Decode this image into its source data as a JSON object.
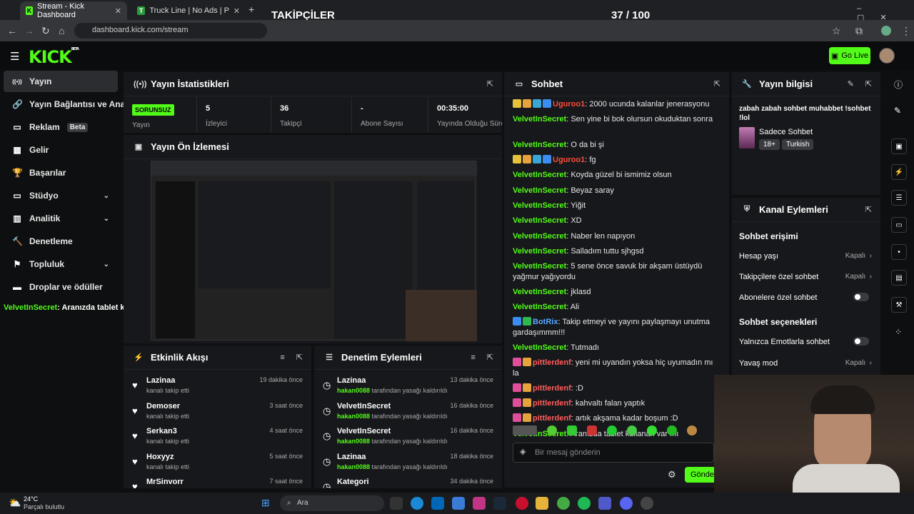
{
  "browser": {
    "tabs": [
      {
        "title": "Stream - Kick Dashboard",
        "active": true
      },
      {
        "title": "Truck Line | No Ads | Play At Fri",
        "active": false
      }
    ],
    "url": "dashboard.kick.com/stream"
  },
  "overlay": {
    "title": "TAKİPÇİLER",
    "count": "37 / 100",
    "progress": 0.37
  },
  "topbar": {
    "logo": "KICK",
    "logo_sup": "BETA",
    "go_live": "Go Live"
  },
  "sidebar": {
    "items": [
      {
        "label": "Yayın",
        "icon": "broadcast-icon",
        "active": true
      },
      {
        "label": "Yayın Bağlantısı ve Anahtarı",
        "icon": "link-icon"
      },
      {
        "label": "Reklam",
        "icon": "ad-icon",
        "badge": "Beta"
      },
      {
        "label": "Gelir",
        "icon": "revenue-icon"
      },
      {
        "label": "Başarılar",
        "icon": "trophy-icon"
      },
      {
        "label": "Stüdyo",
        "icon": "studio-icon",
        "expandable": true
      },
      {
        "label": "Analitik",
        "icon": "analytics-icon",
        "expandable": true
      },
      {
        "label": "Denetleme",
        "icon": "moderation-icon"
      },
      {
        "label": "Topluluk",
        "icon": "community-icon",
        "expandable": true
      },
      {
        "label": "Droplar ve ödüller",
        "icon": "drops-icon"
      }
    ],
    "overlay_chat_user": "VelvetInSecret",
    "overlay_chat_text": ": Aranızda tablet kullanan var mı"
  },
  "stats": {
    "title": "Yayın İstatistikleri",
    "status_badge": "SORUNSUZ",
    "status_label": "Yayın",
    "cells": [
      {
        "value": "5",
        "label": "İzleyici"
      },
      {
        "value": "36",
        "label": "Takipçi"
      },
      {
        "value": "-",
        "label": "Abone Sayısı"
      },
      {
        "value": "00:35:00",
        "label": "Yayında Olduğu Süre"
      }
    ]
  },
  "preview": {
    "title": "Yayın Ön İzlemesi"
  },
  "activity": {
    "title": "Etkinlik Akışı",
    "items": [
      {
        "name": "Lazinaa",
        "sub": "kanalı takip etti",
        "time": "19 dakika önce"
      },
      {
        "name": "Demoser",
        "sub": "kanalı takip etti",
        "time": "3 saat önce"
      },
      {
        "name": "Serkan3",
        "sub": "kanalı takip etti",
        "time": "4 saat önce"
      },
      {
        "name": "Hoxyyz",
        "sub": "kanalı takip etti",
        "time": "5 saat önce"
      },
      {
        "name": "MrSinvorr",
        "sub": "kanalı takip etti",
        "time": "7 saat önce"
      }
    ]
  },
  "moderation": {
    "title": "Denetim Eylemleri",
    "items": [
      {
        "name": "Lazinaa",
        "mod": "hakan0088",
        "sub": " tarafından yasağı kaldırıldı",
        "time": "13 dakika önce"
      },
      {
        "name": "VelvetInSecret",
        "mod": "hakan0088",
        "sub": " tarafından yasağı kaldırıldı",
        "time": "16 dakika önce"
      },
      {
        "name": "VelvetInSecret",
        "mod": "hakan0088",
        "sub": " tarafından yasağı kaldırıldı",
        "time": "16 dakika önce"
      },
      {
        "name": "Lazinaa",
        "mod": "hakan0088",
        "sub": " tarafından yasağı kaldırıldı",
        "time": "18 dakika önce"
      },
      {
        "name": "Kategori",
        "mod": "",
        "sub": "",
        "time": "34 dakika önce"
      }
    ]
  },
  "chat": {
    "title": "Sohbet",
    "messages": [
      {
        "user": "Uguroo1",
        "color": "red",
        "text": ": 2000 ucunda kalanlar jenerasyonu",
        "badges": true
      },
      {
        "user": "VelvetInSecret",
        "color": "green",
        "text": ": Sen yine bi bok olursun okuduktan sonra"
      },
      {
        "user": "VelvetInSecret",
        "color": "green",
        "text": ": O da bi şi"
      },
      {
        "user": "Uguroo1",
        "color": "red",
        "text": ": fg",
        "badges": true
      },
      {
        "user": "VelvetInSecret",
        "color": "green",
        "text": ": Koyda güzel bi ismimiz olsun"
      },
      {
        "user": "VelvetInSecret",
        "color": "green",
        "text": ": Beyaz saray"
      },
      {
        "user": "VelvetInSecret",
        "color": "green",
        "text": ": Yiğit"
      },
      {
        "user": "VelvetInSecret",
        "color": "green",
        "text": ": XD"
      },
      {
        "user": "VelvetInSecret",
        "color": "green",
        "text": ": Naber len napıyon"
      },
      {
        "user": "VelvetInSecret",
        "color": "green",
        "text": ": Salladım tuttu sjhgsd"
      },
      {
        "user": "VelvetInSecret",
        "color": "green",
        "text": ": 5 sene önce savuk bir akşam üstüydü yağmur yağıyordu"
      },
      {
        "user": "VelvetInSecret",
        "color": "green",
        "text": ": jklasd"
      },
      {
        "user": "VelvetInSecret",
        "color": "green",
        "text": ": Ali"
      },
      {
        "user": "BotRix",
        "color": "blue",
        "text": ": Takip etmeyi ve yayını paylaşmayı unutma gardaşımmm!!!",
        "badges": true
      },
      {
        "user": "VelvetInSecret",
        "color": "green",
        "text": ": Tutmadı"
      },
      {
        "user": "pittlerdenf",
        "color": "pink",
        "text": ": yeni mi uyandın yoksa hiç uyumadın mı la",
        "badges": true
      },
      {
        "user": "pittlerdenf",
        "color": "pink",
        "text": ": :D",
        "badges": true
      },
      {
        "user": "pittlerdenf",
        "color": "pink",
        "text": ": kahvaltı falan yaptık",
        "badges": true
      },
      {
        "user": "pittlerdenf",
        "color": "pink",
        "text": ": artık akşama kadar boşum :D",
        "badges": true
      },
      {
        "user": "VelvetInSecret",
        "color": "green",
        "text": ": Aranızda tablet kullanan var mı"
      }
    ],
    "input_placeholder": "Bir mesaj gönderin",
    "send_label": "Gönder"
  },
  "stream_info": {
    "title": "Yayın bilgisi",
    "stream_title": "zabah zabah sohbet muhabbet !sohbet !lol",
    "category": "Sadece Sohbet",
    "tags": [
      "18+",
      "Turkish"
    ]
  },
  "channel_actions": {
    "title": "Kanal Eylemleri",
    "chat_access_title": "Sohbet erişimi",
    "rows": [
      {
        "label": "Hesap yaşı",
        "value": "Kapalı"
      },
      {
        "label": "Takipçilere özel sohbet",
        "value": "Kapalı"
      },
      {
        "label": "Abonelere özel sohbet",
        "toggle": false
      }
    ],
    "chat_options_title": "Sohbet seçenekleri",
    "options": [
      {
        "label": "Yalnızca Emotlarla sohbet",
        "toggle": false
      },
      {
        "label": "Yavaş mod",
        "value": "Kapalı"
      }
    ]
  },
  "taskbar": {
    "weather_temp": "24°C",
    "weather_desc": "Parçalı bulutlu",
    "search": "Ara"
  },
  "colors": {
    "accent": "#53fc18",
    "panel": "#17181b",
    "bg": "#0e0f10"
  }
}
